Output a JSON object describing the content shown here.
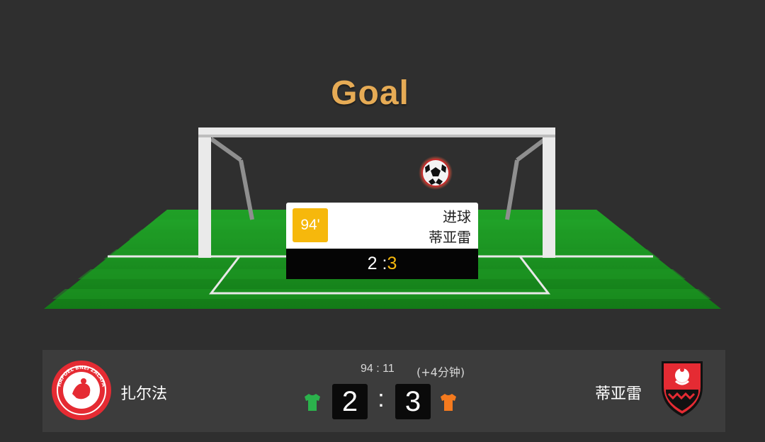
{
  "animation": {
    "title": "Goal",
    "event": {
      "minute": "94'",
      "type": "进球",
      "team": "蒂亚雷",
      "score_home": "2",
      "score_separator": ":",
      "score_away": "3"
    }
  },
  "scoreboard": {
    "home_team": "扎尔法",
    "away_team": "蒂亚雷",
    "match_time": "94 : 11",
    "added_time": "(+4分钟)",
    "home_score": "2",
    "away_score": "3",
    "separator": ":",
    "home_logo_text": "HAPOEL BNEI ZALAFA",
    "home_kit_color": "#2bb24c",
    "away_kit_color": "#f47a1e"
  },
  "colors": {
    "background": "#2f2f2f",
    "title": "#e6ab55",
    "pitch": "#1f8f1f",
    "badge": "#f6b80c",
    "home_logo": "#e52b33",
    "away_logo": "#e52b33"
  }
}
